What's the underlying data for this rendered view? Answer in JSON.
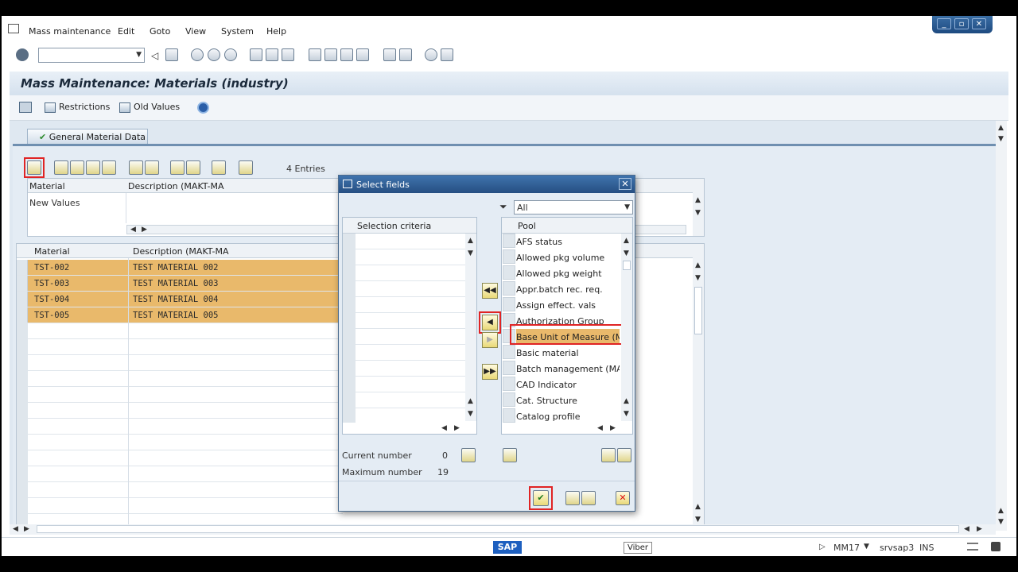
{
  "menu": {
    "items": [
      "Mass maintenance",
      "Edit",
      "Goto",
      "View",
      "System",
      "Help"
    ]
  },
  "window_controls": {
    "minimize": "_",
    "restore": "▫",
    "close": "✕"
  },
  "page": {
    "title": "Mass Maintenance: Materials (industry)"
  },
  "app_toolbar": {
    "restrictions": "Restrictions",
    "old_values": "Old Values"
  },
  "tab": {
    "label": "General Material Data"
  },
  "entries_label": "4 Entries",
  "upper_grid": {
    "columns": [
      "Material",
      "Description (MAKT-MA"
    ],
    "row_label": "New Values"
  },
  "lower_grid": {
    "columns": [
      "Material",
      "Description (MAKT-MA"
    ],
    "rows": [
      {
        "material": "TST-002",
        "description": "TEST MATERIAL 002"
      },
      {
        "material": "TST-003",
        "description": "TEST MATERIAL 003"
      },
      {
        "material": "TST-004",
        "description": "TEST MATERIAL 004"
      },
      {
        "material": "TST-005",
        "description": "TEST MATERIAL 005"
      }
    ]
  },
  "dialog": {
    "title": "Select fields",
    "filter_value": "All",
    "selection_header": "Selection criteria",
    "pool_header": "Pool",
    "pool_items": [
      "AFS status",
      "Allowed pkg volume",
      "Allowed pkg weight",
      "Appr.batch rec. req.",
      "Assign effect. vals",
      "Authorization Group",
      "Base Unit of Measure (M.",
      "Basic material",
      "Batch management (MA",
      "CAD Indicator",
      "Cat. Structure",
      "Catalog profile"
    ],
    "highlighted_item": "Base Unit of Measure (M.",
    "current_number_label": "Current number",
    "current_number_value": "0",
    "maximum_number_label": "Maximum number",
    "maximum_number_value": "19"
  },
  "status": {
    "logo": "SAP",
    "tooltip": "Viber",
    "transaction": "MM17",
    "server": "srvsap3",
    "mode": "INS"
  },
  "colors": {
    "row_highlight": "#e9b96b",
    "accent_red": "#e02424",
    "title_blue": "#2f5f95"
  }
}
